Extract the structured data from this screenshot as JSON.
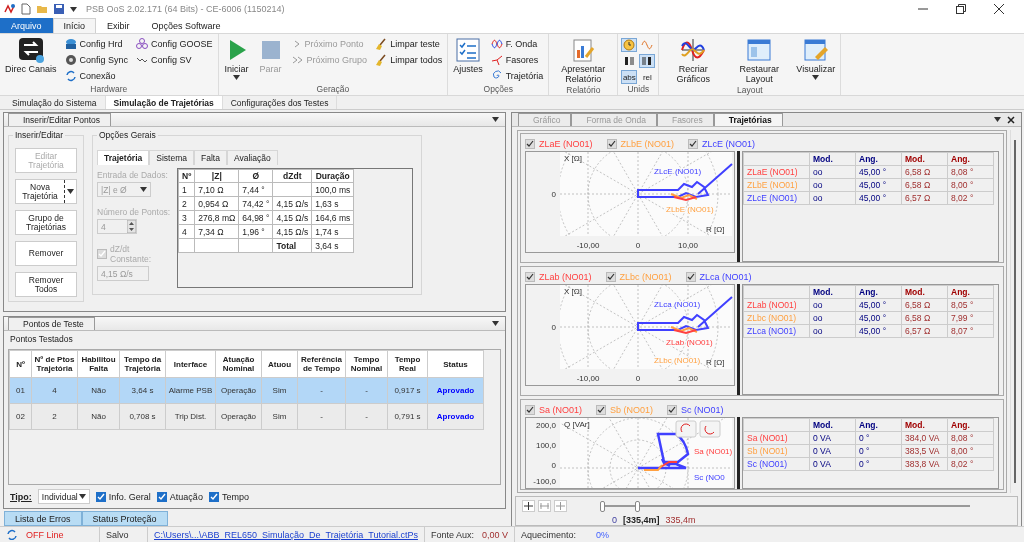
{
  "window": {
    "title": "PSB OoS 2.02.171 (64 Bits) - CE-6006 (1150214)"
  },
  "ribbon_tabs": [
    {
      "label": "Arquivo",
      "kind": "file",
      "selected": false
    },
    {
      "label": "Início",
      "kind": "tab",
      "selected": true
    },
    {
      "label": "Exibir",
      "kind": "tab",
      "selected": false
    },
    {
      "label": "Opções Software",
      "kind": "tab",
      "selected": false
    }
  ],
  "ribbon_groups": [
    {
      "title": "Hardware",
      "items": [
        {
          "kind": "large",
          "label": "Direc Canais",
          "disabled": false,
          "dropdown": false
        },
        {
          "kind": "stack",
          "items": [
            {
              "label": "Config Hrd",
              "disabled": false
            },
            {
              "label": "Config Sync",
              "disabled": false
            },
            {
              "label": "Conexão",
              "disabled": false
            }
          ]
        },
        {
          "kind": "stack",
          "items": [
            {
              "label": "Config GOOSE",
              "disabled": false
            },
            {
              "label": "Config SV",
              "disabled": false
            }
          ]
        }
      ]
    },
    {
      "title": "Geração",
      "items": [
        {
          "kind": "large",
          "label": "Iniciar",
          "disabled": false,
          "dropdown": true
        },
        {
          "kind": "large",
          "label": "Parar",
          "disabled": true,
          "dropdown": false
        },
        {
          "kind": "stack",
          "items": [
            {
              "label": "Próximo Ponto",
              "disabled": true
            },
            {
              "label": "Próximo Grupo",
              "disabled": true
            }
          ]
        },
        {
          "kind": "stack",
          "items": [
            {
              "label": "Limpar teste",
              "disabled": false
            },
            {
              "label": "Limpar todos",
              "disabled": false
            }
          ]
        }
      ]
    },
    {
      "title": "Opções",
      "items": [
        {
          "kind": "large",
          "label": "Ajustes",
          "disabled": false,
          "dropdown": false
        },
        {
          "kind": "stack",
          "items": [
            {
              "label": "F. Onda",
              "disabled": false
            },
            {
              "label": "Fasores",
              "disabled": false
            },
            {
              "label": "Trajetória",
              "disabled": false
            }
          ]
        }
      ]
    },
    {
      "title": "Relatório",
      "items": [
        {
          "kind": "large",
          "label": "Apresentar Relatório",
          "disabled": false,
          "dropdown": false
        }
      ]
    },
    {
      "title": "Unids",
      "items": [
        {
          "kind": "toggles",
          "items": [
            {
              "selected": true
            },
            {
              "selected": false
            },
            {
              "selected": false
            },
            {
              "selected": true
            },
            {
              "label": "abs",
              "selected": true
            },
            {
              "label": "rel",
              "selected": false
            }
          ]
        }
      ]
    },
    {
      "title": "Layout",
      "items": [
        {
          "kind": "large",
          "label": "Recriar Gráficos",
          "disabled": false,
          "dropdown": false
        },
        {
          "kind": "large",
          "label": "Restaurar Layout",
          "disabled": false,
          "dropdown": false
        },
        {
          "kind": "large",
          "label": "Visualizar",
          "disabled": false,
          "dropdown": true
        }
      ]
    }
  ],
  "doc_tabs": [
    {
      "label": "Simulação do Sistema",
      "selected": false
    },
    {
      "label": "Simulação de Trajetórias",
      "selected": true
    },
    {
      "label": "Configurações dos Testes",
      "selected": false
    }
  ],
  "editor_panel": {
    "tab": "Inserir/Editar Pontos",
    "edit_group": {
      "title": "Inserir/Editar",
      "buttons": [
        {
          "label": "Editar Trajetória",
          "kind": "plain",
          "disabled": true
        },
        {
          "label": "Nova Trajetória",
          "kind": "split",
          "disabled": false
        },
        {
          "label": "Grupo de Trajetórias",
          "kind": "plain",
          "disabled": false
        },
        {
          "label": "Remover",
          "kind": "plain",
          "disabled": false
        },
        {
          "label": "Remover Todos",
          "kind": "plain",
          "disabled": false
        }
      ]
    },
    "options_group": {
      "title": "Opções Gerais",
      "tabs": [
        {
          "label": "Trajetória",
          "selected": true
        },
        {
          "label": "Sistema",
          "selected": false
        },
        {
          "label": "Falta",
          "selected": false
        },
        {
          "label": "Avaliação",
          "selected": false
        }
      ],
      "data_entry": {
        "label": "Entrada de Dados:",
        "value": "|Z| e Ø",
        "disabled": true
      },
      "point_count": {
        "label": "Número de Pontos:",
        "value": "4",
        "disabled": true
      },
      "constant_dzdt": {
        "label": "dZ/dt Constante:",
        "checked": true,
        "disabled": true,
        "value": "4,15 Ω/s"
      },
      "table": {
        "columns": [
          "Nº",
          "|Z|",
          "Ø",
          "dZdt",
          "Duração"
        ],
        "rows": [
          {
            "kind": "point",
            "cells": [
              "1",
              "7,10 Ω",
              "7,44 °",
              "",
              "100,0 ms"
            ]
          },
          {
            "kind": "point",
            "cells": [
              "2",
              "0,954 Ω",
              "74,42 °",
              "4,15 Ω/s",
              "1,63 s"
            ]
          },
          {
            "kind": "point",
            "cells": [
              "3",
              "276,8 mΩ",
              "64,98 °",
              "4,15 Ω/s",
              "164,6 ms"
            ]
          },
          {
            "kind": "point",
            "cells": [
              "4",
              "7,34 Ω",
              "1,96 °",
              "4,15 Ω/s",
              "1,74 s"
            ]
          },
          {
            "kind": "total",
            "cells": [
              "",
              "",
              "",
              "Total",
              "3,64 s"
            ]
          }
        ]
      }
    }
  },
  "test_points_panel": {
    "tab": "Pontos de Teste",
    "title": "Pontos Testados",
    "columns": [
      "Nº",
      "Nº de Ptos Trajetória",
      "Habilitou Falta",
      "Tempo da Trajetória",
      "Interface",
      "Atuação Nominal",
      "Atuou",
      "Referência de Tempo",
      "Tempo Nominal",
      "Tempo Real",
      "Status"
    ],
    "rows": [
      {
        "selected": true,
        "cells": [
          "01",
          "4",
          "Não",
          "3,64 s",
          "Alarme PSB",
          "Operação",
          "Sim",
          "-",
          "-",
          "0,917 s",
          "Aprovado"
        ]
      },
      {
        "selected": false,
        "cells": [
          "02",
          "2",
          "Não",
          "0,708 s",
          "Trip Dist.",
          "Operação",
          "Sim",
          "-",
          "-",
          "0,791 s",
          "Aprovado"
        ]
      }
    ],
    "filter": {
      "label": "Tipo:",
      "value": "Individual",
      "checkboxes": [
        {
          "label": "Info. Geral",
          "checked": true
        },
        {
          "label": "Atuação",
          "checked": true
        },
        {
          "label": "Tempo",
          "checked": true
        }
      ]
    }
  },
  "bottom_tabs": [
    {
      "label": "Lista de Erros"
    },
    {
      "label": "Status Proteção"
    }
  ],
  "right_panel": {
    "tabs": [
      {
        "label": "Gráfico",
        "selected": false
      },
      {
        "label": "Forma de Onda",
        "selected": false
      },
      {
        "label": "Fasores",
        "selected": false
      },
      {
        "label": "Trajetórias",
        "selected": true
      }
    ],
    "charts": [
      {
        "kind": "impedance",
        "legend": [
          {
            "label": "ZLaE (NO01)",
            "color": "#ff4040",
            "checked": true
          },
          {
            "label": "ZLbE (NO01)",
            "color": "#ffa040",
            "checked": true
          },
          {
            "label": "ZLcE (NO01)",
            "color": "#4040ff",
            "checked": true
          }
        ],
        "y_label": "X [Ω]",
        "x_label": "R [Ω]",
        "x_ticks": [
          "-10,00",
          "0",
          "10,00"
        ],
        "y_ticks": [
          "0"
        ],
        "curve_labels": [
          {
            "text": "ZLcE (NO01)",
            "kind": "phase_c"
          },
          {
            "text": "ZLbE (NO01)",
            "kind": "phase_b"
          }
        ],
        "table": {
          "columns": [
            {
              "label": "Mod.",
              "kind": "reference"
            },
            {
              "label": "Ang.",
              "kind": "reference"
            },
            {
              "label": "Mod.",
              "kind": "measured"
            },
            {
              "label": "Ang.",
              "kind": "measured"
            }
          ],
          "rows": [
            {
              "label": "ZLaE (NO01)",
              "cells": [
                "oo",
                "45,00 °",
                "6,58 Ω",
                "8,08 °"
              ]
            },
            {
              "label": "ZLbE (NO01)",
              "cells": [
                "oo",
                "45,00 °",
                "6,58 Ω",
                "8,00 °"
              ]
            },
            {
              "label": "ZLcE (NO01)",
              "cells": [
                "oo",
                "45,00 °",
                "6,57 Ω",
                "8,02 °"
              ]
            }
          ]
        }
      },
      {
        "kind": "impedance",
        "legend": [
          {
            "label": "ZLab (NO01)",
            "color": "#ff4040",
            "checked": true
          },
          {
            "label": "ZLbc (NO01)",
            "color": "#ffa040",
            "checked": true
          },
          {
            "label": "ZLca (NO01)",
            "color": "#4040ff",
            "checked": true
          }
        ],
        "y_label": "X [Ω]",
        "x_label": "R [Ω]",
        "x_ticks": [
          "-10,00",
          "0",
          "10,00"
        ],
        "y_ticks": [
          "0"
        ],
        "curve_labels": [
          {
            "text": "ZLca (NO01)",
            "kind": "phase_c"
          },
          {
            "text": "ZLab (NO01)",
            "kind": "phase_a"
          },
          {
            "text": "ZLbc (NO01)",
            "kind": "phase_b"
          }
        ],
        "table": {
          "columns": [
            {
              "label": "Mod.",
              "kind": "reference"
            },
            {
              "label": "Ang.",
              "kind": "reference"
            },
            {
              "label": "Mod.",
              "kind": "measured"
            },
            {
              "label": "Ang.",
              "kind": "measured"
            }
          ],
          "rows": [
            {
              "label": "ZLab (NO01)",
              "cells": [
                "oo",
                "45,00 °",
                "6,58 Ω",
                "8,05 °"
              ]
            },
            {
              "label": "ZLbc (NO01)",
              "cells": [
                "oo",
                "45,00 °",
                "6,58 Ω",
                "7,99 °"
              ]
            },
            {
              "label": "ZLca (NO01)",
              "cells": [
                "oo",
                "45,00 °",
                "6,57 Ω",
                "8,07 °"
              ]
            }
          ]
        }
      },
      {
        "kind": "power",
        "legend": [
          {
            "label": "Sa (NO01)",
            "color": "#ff4040",
            "checked": true
          },
          {
            "label": "Sb (NO01)",
            "color": "#ffa040",
            "checked": true
          },
          {
            "label": "Sc (NO01)",
            "color": "#4040ff",
            "checked": true
          }
        ],
        "y_label": "Q [VAr]",
        "y_ticks": [
          "200,0",
          "100,0",
          "0",
          "-100,0"
        ],
        "curve_labels": [
          {
            "text": "Sa (NO01)",
            "kind": "phase_a"
          },
          {
            "text": "Sc (NO0",
            "kind": "phase_c"
          }
        ],
        "table": {
          "columns": [
            {
              "label": "Mod.",
              "kind": "reference"
            },
            {
              "label": "Ang.",
              "kind": "reference"
            },
            {
              "label": "Mod.",
              "kind": "measured"
            },
            {
              "label": "Ang.",
              "kind": "measured"
            }
          ],
          "rows": [
            {
              "label": "Sa (NO01)",
              "cells": [
                "0 VA",
                "0 °",
                "384,0 VA",
                "8,08 °"
              ]
            },
            {
              "label": "Sb (NO01)",
              "cells": [
                "0 VA",
                "0 °",
                "383,5 VA",
                "8,00 °"
              ]
            },
            {
              "label": "Sc (NO01)",
              "cells": [
                "0 VA",
                "0 °",
                "383,8 VA",
                "8,02 °"
              ]
            }
          ]
        }
      }
    ],
    "time_slider": {
      "level": 0.1,
      "start": "0",
      "cursor": "[335,4m]",
      "end": "335,4m"
    }
  },
  "status_bar": {
    "connection": "OFF Line",
    "save_state": "Salvo",
    "file_path": "C:\\Users\\...\\ABB_REL650_Simulação_De_Trajetória_Tutorial.ctPs",
    "aux_label": "Fonte Aux:",
    "aux_value": "0,00 V",
    "heating_label": "Aquecimento:",
    "heating_value": "0%"
  }
}
